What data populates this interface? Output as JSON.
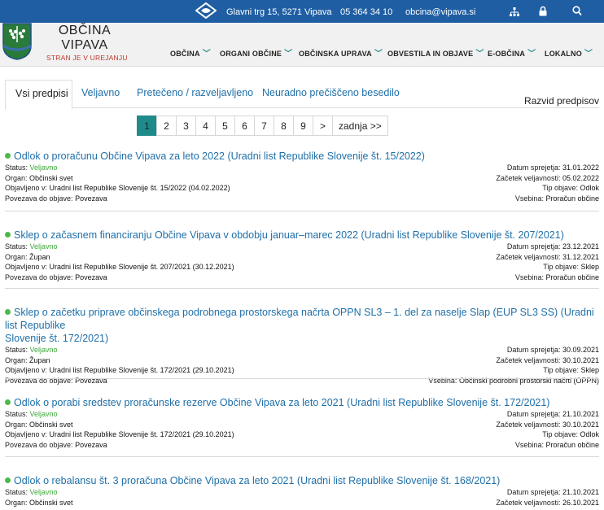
{
  "topbar": {
    "address": "Glavni trg 15, 5271 Vipava",
    "phone": "05 364 34 10",
    "email": "obcina@vipava.si"
  },
  "brand": {
    "line1": "OBČINA",
    "line2": "VIPAVA",
    "tagline": "STRAN JE V UREJANJU"
  },
  "nav": [
    "OBČINA",
    "ORGANI OBČINE",
    "OBČINSKA UPRAVA",
    "OBVESTILA IN OBJAVE",
    "E-OBČINA",
    "LOKALNO"
  ],
  "tabs": [
    "Vsi predpisi",
    "Veljavno",
    "Pretečeno / razveljavljeno",
    "Neuradno prečiščeno besedilo"
  ],
  "razvid": "Razvid predpisov",
  "pager": [
    "1",
    "2",
    "3",
    "4",
    "5",
    "6",
    "7",
    "8",
    "9",
    ">",
    "zadnja >>"
  ],
  "labels": {
    "status": "Status: ",
    "organ": "Organ: ",
    "objavljeno": "Objavljeno v: ",
    "povezava": "Povezava do objave: ",
    "datum": "Datum sprejetja: ",
    "zacetek": "Začetek veljavnosti: ",
    "tip": "Tip objave: ",
    "vsebina": "Vsebina: "
  },
  "entries": [
    {
      "title": "Odlok o proračunu Občine Vipava za leto 2022 (Uradni list Republike Slovenije št. 15/2022)",
      "status": "Veljavno",
      "organ": "Občinski svet",
      "objavljeno": "Uradni list Republike Slovenije št. 15/2022 (04.02.2022)",
      "povezava": "Povezava",
      "datum": "31.01.2022",
      "zacetek": "05.02.2022",
      "tip": "Odlok",
      "vsebina": "Proračun občine"
    },
    {
      "title": "Sklep o začasnem financiranju Občine Vipava v obdobju januar–marec 2022 (Uradni list Republike Slovenije št. 207/2021)",
      "status": "Veljavno",
      "organ": "Župan",
      "objavljeno": "Uradni list Republike Slovenije št. 207/2021 (30.12.2021)",
      "povezava": "Povezava",
      "datum": "23.12.2021",
      "zacetek": "31.12.2021",
      "tip": "Sklep",
      "vsebina": "Proračun občine"
    },
    {
      "title_l1": "Sklep o začetku priprave občinskega podrobnega prostorskega načrta OPPN SL3 – 1. del za naselje Slap (EUP SL3 SS) (Uradni list Republike",
      "title_l2": "Slovenije št. 172/2021)",
      "status": "Veljavno",
      "organ": "Župan",
      "objavljeno": "Uradni list Republike Slovenije št. 172/2021 (29.10.2021)",
      "povezava": "Povezava",
      "datum": "30.09.2021",
      "zacetek": "30.10.2021",
      "tip": "Sklep",
      "vsebina": "Občinski podrobni prostorski načrti (OPPN)"
    },
    {
      "title": "Odlok o porabi sredstev proračunske rezerve Občine Vipava za leto 2021 (Uradni list Republike Slovenije št. 172/2021)",
      "status": "Veljavno",
      "organ": "Občinski svet",
      "objavljeno": "Uradni list Republike Slovenije št. 172/2021 (29.10.2021)",
      "povezava": "Povezava",
      "datum": "21.10.2021",
      "zacetek": "30.10.2021",
      "tip": "Odlok",
      "vsebina": "Proračun občine"
    },
    {
      "title": "Odlok o rebalansu št. 3 proračuna Občine Vipava za leto 2021 (Uradni list Republike Slovenije št. 168/2021)",
      "status": "Veljavno",
      "organ": "Občinski svet",
      "datum": "21.10.2021",
      "zacetek": "26.10.2021"
    }
  ]
}
